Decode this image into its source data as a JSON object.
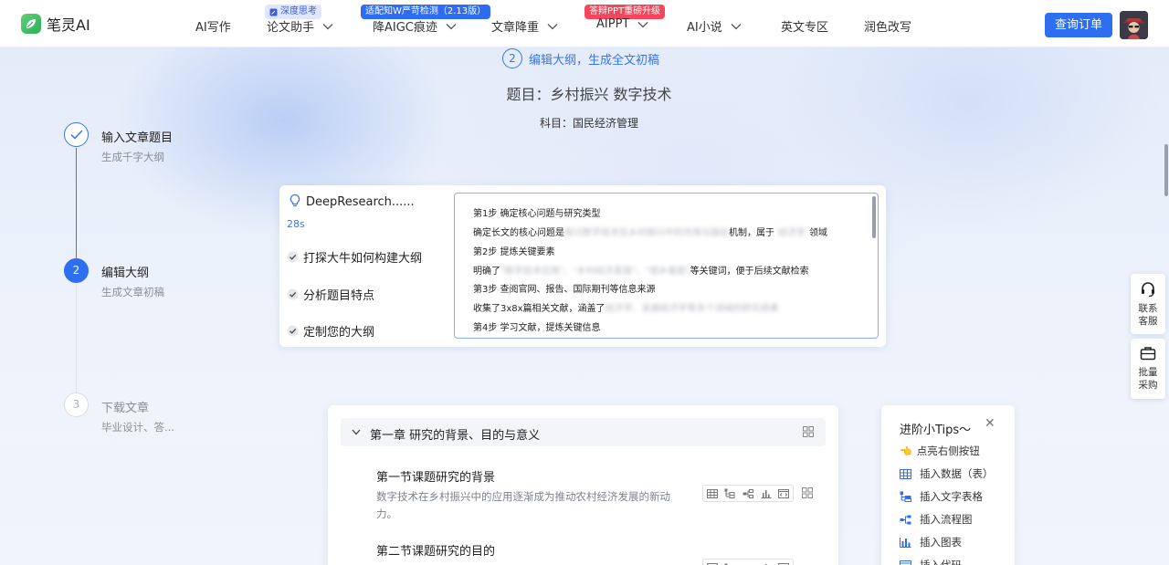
{
  "app": {
    "name": "笔灵AI"
  },
  "nav": {
    "items": [
      {
        "label": "AI写作"
      },
      {
        "label": "论文助手",
        "badge": "深度思考"
      },
      {
        "label": "降AIGC痕迹",
        "badge": "适配知W严苛检测（2.13版）"
      },
      {
        "label": "文章降重"
      },
      {
        "label": "AIPPT",
        "badge": "答辩PPT重磅升级"
      },
      {
        "label": "AI小说"
      },
      {
        "label": "英文专区"
      },
      {
        "label": "润色改写"
      }
    ],
    "order_button": "查询订单"
  },
  "header": {
    "step_number": "2",
    "step_title": "编辑大纲，生成全文初稿",
    "topic": "题目：乡村振兴 数字技术",
    "subject": "科目：国民经济管理"
  },
  "stepper": {
    "steps": [
      {
        "label": "输入文章题目",
        "sub": "生成千字大纲",
        "state": "done"
      },
      {
        "number": "2",
        "label": "编辑大纲",
        "sub": "生成文章初稿",
        "state": "active"
      },
      {
        "number": "3",
        "label": "下载文章",
        "sub": "毕业设计、答...",
        "state": "pending"
      }
    ]
  },
  "research": {
    "title": "DeepResearch......",
    "elapsed": "28s",
    "checks": [
      "打探大牛如何构建大纲",
      "分析题目特点",
      "定制您的大纲"
    ],
    "log": [
      {
        "text": "第1步 确定核心问题与研究类型"
      },
      {
        "pre": "确定长文的核心问题是",
        "blur": "探讨数字技术在乡村振兴中的作用与路径",
        "mid": "机制，属于",
        "blur2": "经济学",
        "post": "领域"
      },
      {
        "text": "第2步 提炼关键要素"
      },
      {
        "pre": "明确了",
        "blur": "\"数字技术应用\"、\"乡村经济发展\"、\"城乡差距\"",
        "post": "等关键词，便于后续文献检索"
      },
      {
        "text": "第3步 查阅官网、报告、国际期刊等信息来源"
      },
      {
        "pre": "收集了3x8x篇相关文献，涵盖了",
        "blur": "经济学、发展经济学等多个领域的研究成果"
      },
      {
        "text": "第4步 学习文献，提炼关键信息"
      }
    ]
  },
  "outline": {
    "chapter": "第一章 研究的背景、目的与意义",
    "sections": [
      {
        "title": "第一节课题研究的背景",
        "desc": "数字技术在乡村振兴中的应用逐渐成为推动农村经济发展的新动力。"
      },
      {
        "title": "第二节课题研究的目的",
        "desc": ""
      }
    ]
  },
  "tips": {
    "title": "进阶小Tips～",
    "items": [
      {
        "icon": "pointing-hand-icon",
        "label": "点亮右侧按钮"
      },
      {
        "icon": "table-icon",
        "label": "插入数据（表）"
      },
      {
        "icon": "text-table-icon",
        "label": "插入文字表格"
      },
      {
        "icon": "flowchart-icon",
        "label": "插入流程图"
      },
      {
        "icon": "bar-chart-icon",
        "label": "插入图表"
      },
      {
        "icon": "code-icon",
        "label": "插入代码"
      }
    ]
  },
  "float": {
    "service": "联系客服",
    "bulk": "批量采购"
  },
  "colors": {
    "accent": "#2d6ff0",
    "badge_red": "#f5475c",
    "logo_green": "#2fae57"
  }
}
